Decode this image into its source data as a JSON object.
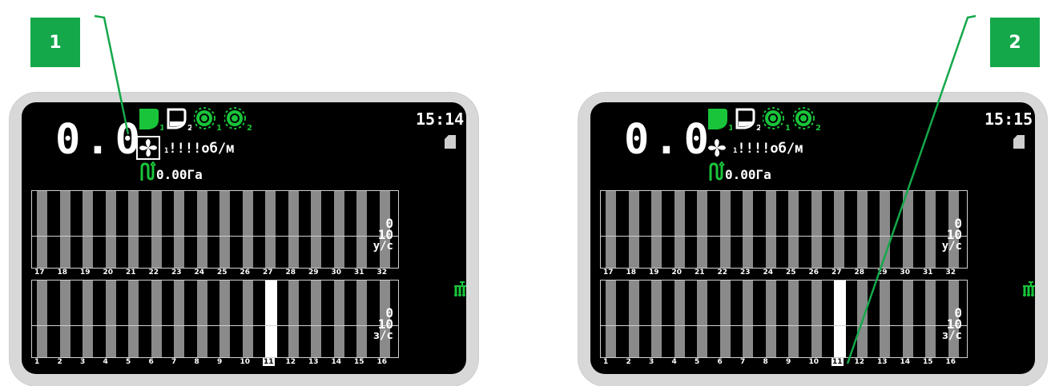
{
  "callouts": [
    {
      "label": "1"
    },
    {
      "label": "2"
    }
  ],
  "panels": [
    {
      "speed": "0.0",
      "clock": "15:14",
      "rpm": "!!!!об/м",
      "fan_index": "1",
      "fan_highlighted": true,
      "area": "0.00Га",
      "hopper_indices": [
        "1",
        "2"
      ],
      "sensor_indices": [
        "1",
        "2"
      ],
      "top_bar_numbers": [
        "17",
        "18",
        "19",
        "20",
        "21",
        "22",
        "23",
        "24",
        "25",
        "26",
        "27",
        "28",
        "29",
        "30",
        "31",
        "32"
      ],
      "bottom_bar_numbers": [
        "1",
        "2",
        "3",
        "4",
        "5",
        "6",
        "7",
        "8",
        "9",
        "10",
        "11",
        "12",
        "13",
        "14",
        "15",
        "16"
      ],
      "top_scale": {
        "max": "0",
        "min": "10",
        "unit": "у/с"
      },
      "bottom_scale": {
        "max": "0",
        "min": "10",
        "unit": "з/с"
      },
      "alert_mark": "!",
      "highlighted_section": "11"
    },
    {
      "speed": "0.0",
      "clock": "15:15",
      "rpm": "!!!!об/м",
      "fan_index": "1",
      "fan_highlighted": false,
      "area": "0.00Га",
      "hopper_indices": [
        "1",
        "2"
      ],
      "sensor_indices": [
        "1",
        "2"
      ],
      "top_bar_numbers": [
        "17",
        "18",
        "19",
        "20",
        "21",
        "22",
        "23",
        "24",
        "25",
        "26",
        "27",
        "28",
        "29",
        "30",
        "31",
        "32"
      ],
      "bottom_bar_numbers": [
        "1",
        "2",
        "3",
        "4",
        "5",
        "6",
        "7",
        "8",
        "9",
        "10",
        "11",
        "12",
        "13",
        "14",
        "15",
        "16"
      ],
      "top_scale": {
        "max": "0",
        "min": "10",
        "unit": "у/с"
      },
      "bottom_scale": {
        "max": "0",
        "min": "10",
        "unit": "з/с"
      },
      "alert_mark": "!",
      "highlighted_section": "11"
    }
  ],
  "colors": {
    "accent": "#14a84a",
    "green_icon": "#19c43a",
    "bar": "#8a8a8a",
    "screen": "#000000"
  },
  "icons": [
    "hopper-full-icon",
    "hopper-empty-icon",
    "seed-sensor-icon",
    "fan-icon",
    "area-counter-icon",
    "sd-card-icon",
    "seeder-icon"
  ]
}
